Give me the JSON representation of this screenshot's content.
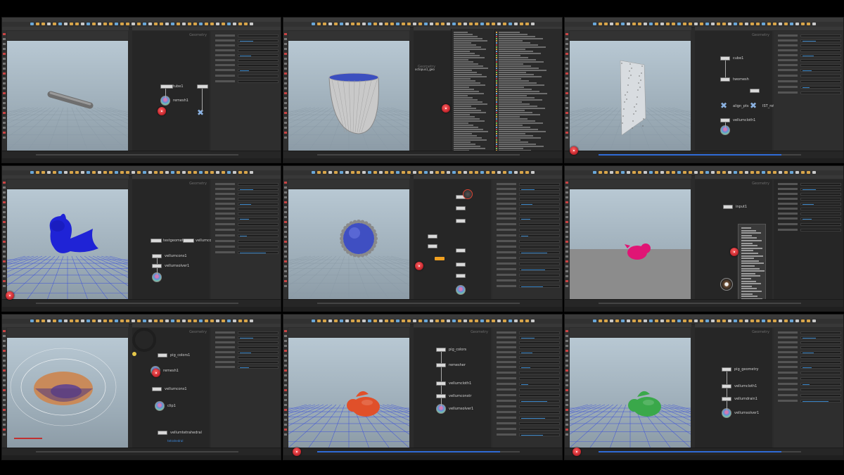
{
  "app": {
    "name": "Houdini"
  },
  "panels": [
    {
      "id": "p1",
      "net_title": "Geometry",
      "nodes": [
        {
          "label": "tube1",
          "kind": "box"
        },
        {
          "label": "remesh1",
          "kind": "ball"
        },
        {
          "label": "",
          "kind": "box"
        },
        {
          "label": "",
          "kind": "x"
        }
      ],
      "object": "tube",
      "object_color": "#8a8a8a"
    },
    {
      "id": "p2",
      "net_title": "octopus1_geo",
      "net_subtitle": "Geometry",
      "object": "bowl",
      "object_color": "#c9c9c9"
    },
    {
      "id": "p3",
      "net_title": "Geometry",
      "nodes": [
        {
          "label": "cube1",
          "kind": "box"
        },
        {
          "label": "twomesh",
          "kind": "box"
        },
        {
          "label": "",
          "kind": "box"
        },
        {
          "label": "align_pts",
          "kind": "x"
        },
        {
          "label": "IST_rot_p",
          "kind": "x"
        },
        {
          "label": "vellumcloth1",
          "kind": "box"
        },
        {
          "label": "",
          "kind": "ball"
        }
      ],
      "object": "cloth",
      "object_color": "#d8dce0"
    },
    {
      "id": "p4",
      "net_title": "Geometry",
      "nodes": [
        {
          "label": "testgeometry",
          "kind": "box"
        },
        {
          "label": "vellumcons",
          "kind": "box"
        },
        {
          "label": "vellumcons1",
          "kind": "box"
        },
        {
          "label": "vellumsolver1",
          "kind": "box"
        },
        {
          "label": "",
          "kind": "ball"
        }
      ],
      "object": "dragon",
      "object_color": "#1f23d6"
    },
    {
      "id": "p5",
      "net_title": "",
      "object": "sphere",
      "object_color": "#3f4fc2"
    },
    {
      "id": "p6",
      "net_title": "Geometry",
      "nodes": [
        {
          "label": "input1",
          "kind": "box"
        }
      ],
      "object": "pig",
      "object_color": "#e01575"
    },
    {
      "id": "p7",
      "net_title": "Geometry",
      "nodes": [
        {
          "label": "pig_colors1",
          "kind": "box"
        },
        {
          "label": "remesh1",
          "kind": "ball"
        },
        {
          "label": "vellumcons1",
          "kind": "box"
        },
        {
          "label": "clip1",
          "kind": "ball"
        },
        {
          "label": "vellumtetrahedral",
          "kind": "box"
        }
      ],
      "sub_label": "tetrahedral",
      "object": "torus",
      "object_color": "#c98a5a"
    },
    {
      "id": "p8",
      "net_title": "Geometry",
      "nodes": [
        {
          "label": "pig_colors",
          "kind": "box"
        },
        {
          "label": "remesher",
          "kind": "box"
        },
        {
          "label": "vellumcloth1",
          "kind": "box"
        },
        {
          "label": "vellumconstr",
          "kind": "box"
        },
        {
          "label": "vellumsolver1",
          "kind": "ball"
        }
      ],
      "object": "pig",
      "object_color": "#e0502a"
    },
    {
      "id": "p9",
      "net_title": "Geometry",
      "nodes": [
        {
          "label": "pig_geometry",
          "kind": "box"
        },
        {
          "label": "vellumcloth1",
          "kind": "box"
        },
        {
          "label": "vellumdrain1",
          "kind": "box"
        },
        {
          "label": "vellumsolver1",
          "kind": "ball"
        }
      ],
      "object": "pig",
      "object_color": "#3aa84a"
    }
  ]
}
